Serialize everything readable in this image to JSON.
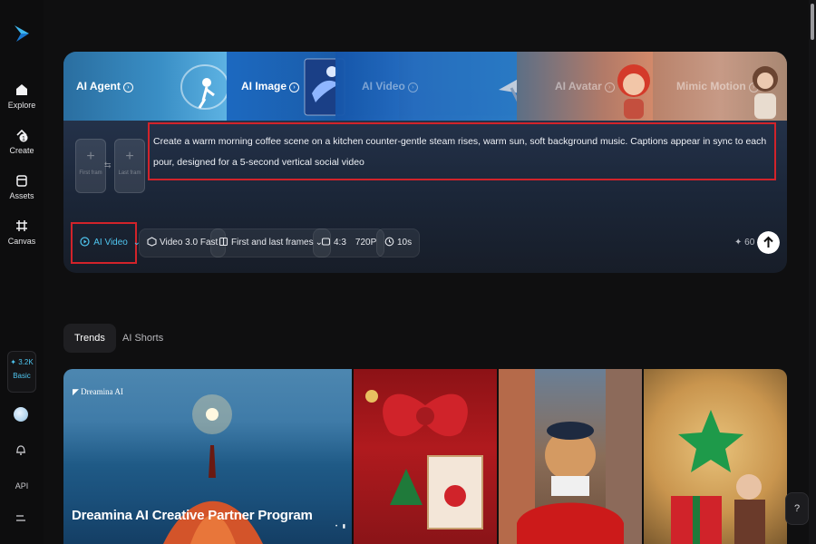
{
  "sidebar": {
    "logo_icon": "dreamina-logo-icon",
    "items": [
      {
        "label": "Explore",
        "icon": "home-icon"
      },
      {
        "label": "Create",
        "icon": "create-icon",
        "badge": "1"
      },
      {
        "label": "Assets",
        "icon": "assets-icon"
      },
      {
        "label": "Canvas",
        "icon": "canvas-icon"
      }
    ],
    "credits": {
      "amount": "✦ 3.2K",
      "tier": "Basic"
    },
    "api_label": "API"
  },
  "hero": {
    "tabs": [
      {
        "label": "AI Agent"
      },
      {
        "label": "AI Image"
      },
      {
        "label": "AI Video"
      },
      {
        "label": "AI Avatar"
      },
      {
        "label": "Mimic Motion"
      }
    ],
    "frames": {
      "first": "First fram",
      "last": "Last fram"
    },
    "prompt_text": "Create a warm morning coffee scene on a kitchen counter-gentle steam rises, warm sun, soft background music. Captions appear in sync to each pour, designed for a 5-second vertical social video",
    "controls": {
      "mode": "AI Video",
      "model": "Video 3.0 Fast",
      "frames_mode": "First and last frames",
      "ratio": "4:3",
      "resolution": "720P",
      "duration": "10s",
      "cost": "60"
    }
  },
  "section_tabs": [
    {
      "label": "Trends",
      "active": true
    },
    {
      "label": "AI Shorts",
      "active": false
    }
  ],
  "gallery": {
    "brand": "Dreamina AI",
    "featured_title": "Dreamina AI Creative Partner Program"
  },
  "colors": {
    "accent": "#4fc6f0",
    "highlight_box": "#d2232a",
    "background": "#0f0f10"
  }
}
